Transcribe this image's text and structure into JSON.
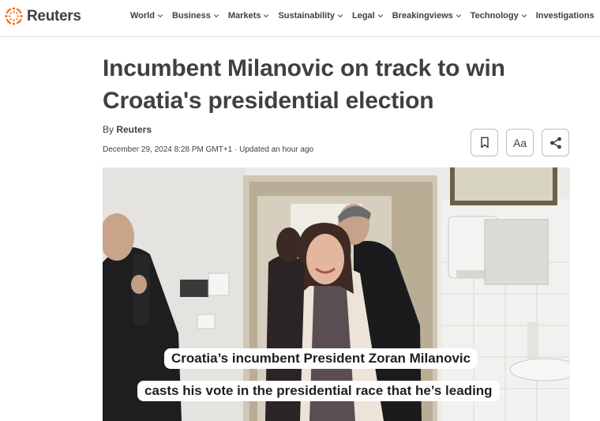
{
  "brand": {
    "name": "Reuters",
    "color": "#fa6400"
  },
  "nav": {
    "items": [
      {
        "label": "World",
        "dropdown": true
      },
      {
        "label": "Business",
        "dropdown": true
      },
      {
        "label": "Markets",
        "dropdown": true
      },
      {
        "label": "Sustainability",
        "dropdown": true
      },
      {
        "label": "Legal",
        "dropdown": true
      },
      {
        "label": "Breakingviews",
        "dropdown": true
      },
      {
        "label": "Technology",
        "dropdown": true
      },
      {
        "label": "Investigations",
        "dropdown": false
      }
    ]
  },
  "article": {
    "headline": "Incumbent Milanovic on track to win Croatia's presidential election",
    "byline_prefix": "By ",
    "byline_author": "Reuters",
    "dateline": "December 29, 2024 8:28 PM GMT+1 · Updated an hour ago"
  },
  "toolbar": {
    "bookmark_icon": "bookmark-icon",
    "text_size_label": "Aa",
    "share_icon": "share-icon"
  },
  "video": {
    "caption_line1": "Croatia’s incumbent President Zoran Milanovic",
    "caption_line2": "casts his vote in the presidential race that he’s leading"
  }
}
